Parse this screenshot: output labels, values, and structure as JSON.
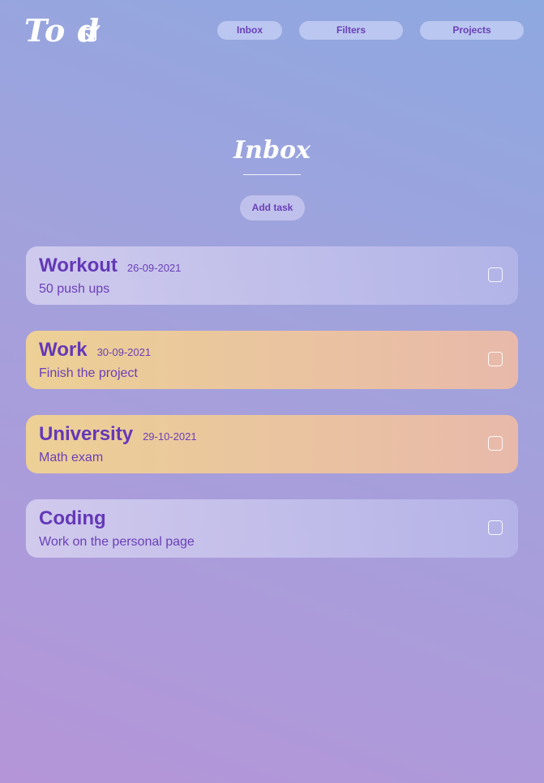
{
  "logo": {
    "text": "To d",
    "icon": "checkbox-icon"
  },
  "nav": {
    "inbox": "Inbox",
    "filters": "Filters",
    "projects": "Projects"
  },
  "page": {
    "title": "Inbox",
    "add_task_label": "Add task"
  },
  "tasks": [
    {
      "title": "Workout",
      "date": "26-09-2021",
      "description": "50 push ups",
      "color": "lavender",
      "checked": false
    },
    {
      "title": "Work",
      "date": "30-09-2021",
      "description": "Finish the project",
      "color": "peach",
      "checked": false
    },
    {
      "title": "University",
      "date": "29-10-2021",
      "description": "Math exam",
      "color": "peach",
      "checked": false
    },
    {
      "title": "Coding",
      "date": "",
      "description": "Work on the personal page",
      "color": "lavender",
      "checked": false
    }
  ],
  "colors": {
    "accent_text": "#6a3fb8",
    "lavender_card": "#c9c6ee",
    "peach_card_start": "#ecd095",
    "peach_card_end": "#e8b9aa"
  }
}
